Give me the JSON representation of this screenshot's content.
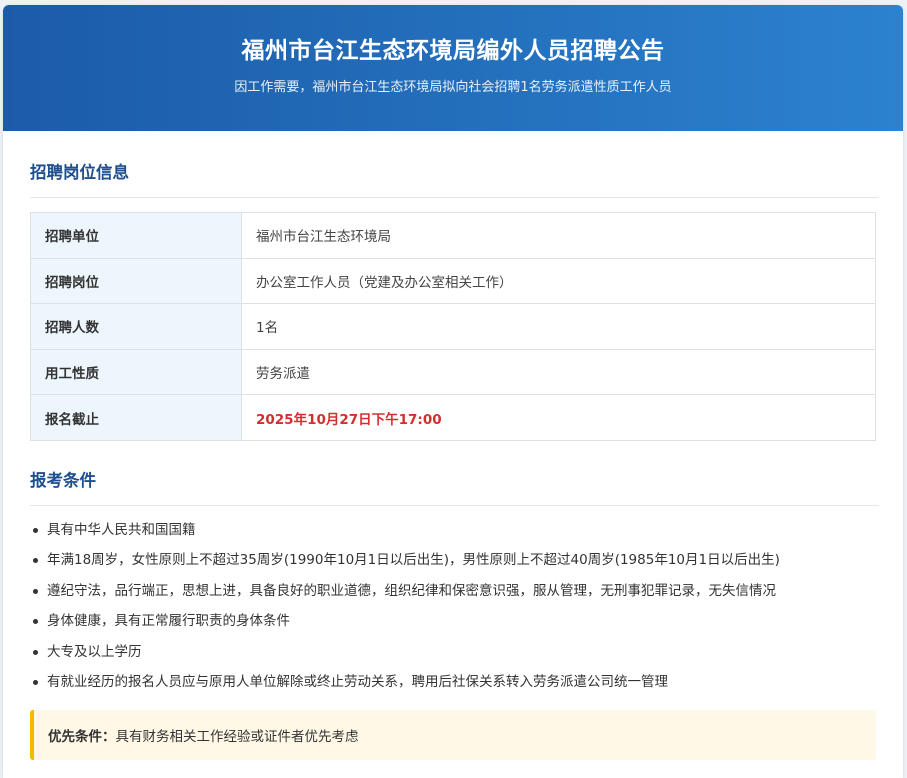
{
  "header": {
    "title": "福州市台江生态环境局编外人员招聘公告",
    "subtitle": "因工作需要，福州市台江生态环境局拟向社会招聘1名劳务派遣性质工作人员"
  },
  "position_section": {
    "title": "招聘岗位信息",
    "rows": [
      {
        "label": "招聘单位",
        "value": "福州市台江生态环境局"
      },
      {
        "label": "招聘岗位",
        "value": "办公室工作人员（党建及办公室相关工作）"
      },
      {
        "label": "招聘人数",
        "value": "1名"
      },
      {
        "label": "用工性质",
        "value": "劳务派遣"
      },
      {
        "label": "报名截止",
        "value": "2025年10月27日下午17:00"
      }
    ]
  },
  "requirements_section": {
    "title": "报考条件",
    "items": [
      "具有中华人民共和国国籍",
      "年满18周岁，女性原则上不超过35周岁(1990年10月1日以后出生)，男性原则上不超过40周岁(1985年10月1日以后出生)",
      "遵纪守法，品行端正，思想上进，具备良好的职业道德，组织纪律和保密意识强，服从管理，无刑事犯罪记录，无失信情况",
      "身体健康，具有正常履行职责的身体条件",
      "大专及以上学历",
      "有就业经历的报名人员应与原用人单位解除或终止劳动关系，聘用后社保关系转入劳务派遣公司统一管理"
    ],
    "priority": {
      "label": "优先条件：",
      "text": "具有财务相关工作经验或证件者优先考虑"
    }
  },
  "colors": {
    "header_start": "#1c5ba7",
    "header_end": "#2c82cf",
    "section_title": "#1f4f8f",
    "deadline": "#d32f2f",
    "label_bg": "#eef6fd",
    "priority_bg": "#fff8e6",
    "priority_border": "#f5b800"
  }
}
